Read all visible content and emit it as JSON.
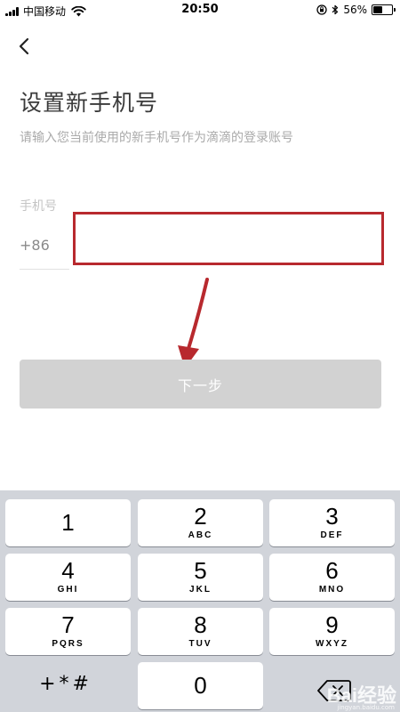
{
  "status_bar": {
    "carrier": "中国移动",
    "time": "20:50",
    "battery_percent": "56%",
    "battery_level": 0.56,
    "icons": [
      "signal-icon",
      "wifi-icon",
      "orientation-lock-icon",
      "bluetooth-icon",
      "battery-icon"
    ]
  },
  "nav": {
    "back_icon": "chevron-left-icon"
  },
  "title": "设置新手机号",
  "subtitle": "请输入您当前使用的新手机号作为滴滴的登录账号",
  "phone_field": {
    "label": "手机号",
    "country_code": "+86",
    "value": "",
    "placeholder": ""
  },
  "next_button": {
    "label": "下一步"
  },
  "keypad": {
    "keys": [
      {
        "digit": "1",
        "letters": ""
      },
      {
        "digit": "2",
        "letters": "ABC"
      },
      {
        "digit": "3",
        "letters": "DEF"
      },
      {
        "digit": "4",
        "letters": "GHI"
      },
      {
        "digit": "5",
        "letters": "JKL"
      },
      {
        "digit": "6",
        "letters": "MNO"
      },
      {
        "digit": "7",
        "letters": "PQRS"
      },
      {
        "digit": "8",
        "letters": "TUV"
      },
      {
        "digit": "9",
        "letters": "WXYZ"
      },
      {
        "digit": "0",
        "letters": ""
      }
    ],
    "symbols_label": "+*#",
    "delete_icon": "backspace-icon"
  },
  "colors": {
    "annotation_red": "#b8292e",
    "button_disabled": "#d2d2d2",
    "keypad_bg": "#d1d4da"
  },
  "watermark": {
    "logo": "Bai经验",
    "sub": "jingyan.baidu.com"
  }
}
